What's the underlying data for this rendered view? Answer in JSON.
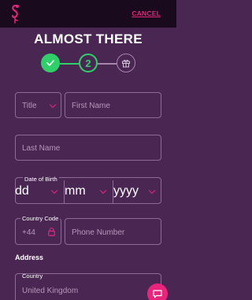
{
  "header": {
    "cancel_label": "CANCEL"
  },
  "title": "ALMOST THERE",
  "stepper": {
    "step2_label": "2"
  },
  "form": {
    "title_placeholder": "Title",
    "first_name_placeholder": "First Name",
    "last_name_placeholder": "Last Name",
    "dob_label": "Date of Birth",
    "dob_day": "dd",
    "dob_month": "mm",
    "dob_year": "yyyy",
    "country_code_label": "Country Code",
    "country_code_value": "+44",
    "phone_placeholder": "Phone Number",
    "address_heading": "Address",
    "country_label": "Country",
    "country_value": "United Kingdom"
  },
  "colors": {
    "accent": "#e8247c",
    "success": "#2fd06a",
    "background": "#4a2752",
    "topbar": "#1a0a1e"
  },
  "icons": [
    "flamingo-logo-icon",
    "check-icon",
    "gift-icon",
    "chevron-down-icon",
    "lock-icon",
    "chat-icon"
  ]
}
